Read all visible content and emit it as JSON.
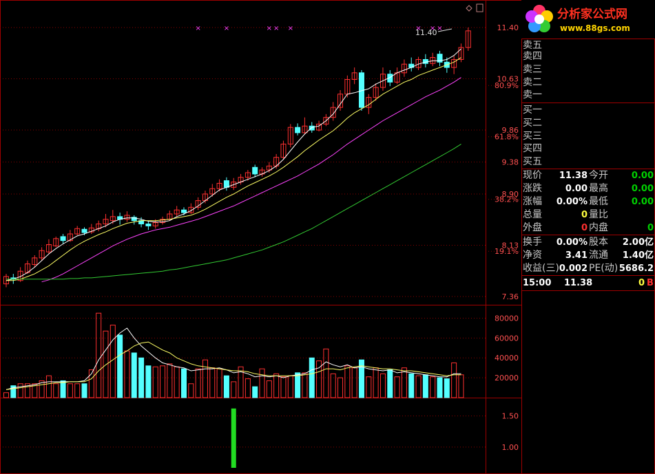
{
  "colors": {
    "up": "#ff3030",
    "down": "#54ffff",
    "ma5": "#ffffff",
    "ma10": "#ffff66",
    "ma20": "#ff44ff",
    "ma60": "#33cc33",
    "grid": "#8b0000",
    "axis_text": "#ff5050",
    "signal": "#22dd22",
    "marker": "#ff44ff"
  },
  "price_axis": {
    "ticks": [
      "11.40",
      "10.63",
      "9.86",
      "9.38",
      "8.90",
      "8.13",
      "7.36"
    ],
    "percent_labels": [
      "80.9%",
      "61.8%",
      "38.2%",
      "19.1%"
    ]
  },
  "price_annotation": "11.40",
  "volume_axis": {
    "ticks": [
      "80000",
      "60000",
      "40000",
      "20000"
    ]
  },
  "indicator_axis": {
    "ticks": [
      "1.50",
      "1.00"
    ]
  },
  "logo": {
    "title": "分析家公式网",
    "url": "www.88gs.com"
  },
  "order_book": {
    "sell": [
      "卖五",
      "卖四",
      "卖三",
      "卖二",
      "卖一"
    ],
    "buy": [
      "买一",
      "买二",
      "买三",
      "买四",
      "买五"
    ]
  },
  "quote": {
    "rows": [
      {
        "l1": "现价",
        "v1": "11.38",
        "l2": "今开",
        "v2": "0.00"
      },
      {
        "l1": "涨跌",
        "v1": "0.00",
        "l2": "最高",
        "v2": "0.00"
      },
      {
        "l1": "涨幅",
        "v1": "0.00%",
        "l2": "最低",
        "v2": "0.00"
      },
      {
        "l1": "总量",
        "v1": "0",
        "l2": "量比",
        "v2": ""
      },
      {
        "l1": "外盘",
        "v1": "0",
        "l2": "内盘",
        "v2": "0"
      }
    ],
    "rows2": [
      {
        "l1": "换手",
        "v1": "0.00%",
        "l2": "股本",
        "v2": "2.00亿"
      },
      {
        "l1": "净资",
        "v1": "3.41",
        "l2": "流通",
        "v2": "1.40亿"
      },
      {
        "l1": "收益(三)",
        "v1": "0.002",
        "l2": "PE(动)",
        "v2": "5686.2"
      }
    ]
  },
  "tick": {
    "time": "15:00",
    "price": "11.38",
    "vol": "0",
    "side": "B"
  },
  "chart_data": {
    "type": "candlestick",
    "price_range": [
      7.36,
      11.4
    ],
    "candles": [
      {
        "o": 7.55,
        "c": 7.66,
        "h": 7.7,
        "l": 7.5
      },
      {
        "o": 7.64,
        "c": 7.62,
        "h": 7.7,
        "l": 7.55
      },
      {
        "o": 7.6,
        "c": 7.74,
        "h": 7.8,
        "l": 7.58
      },
      {
        "o": 7.72,
        "c": 7.85,
        "h": 7.9,
        "l": 7.7
      },
      {
        "o": 7.84,
        "c": 7.94,
        "h": 7.98,
        "l": 7.8
      },
      {
        "o": 7.94,
        "c": 8.05,
        "h": 8.1,
        "l": 7.9
      },
      {
        "o": 8.03,
        "c": 8.14,
        "h": 8.22,
        "l": 8.0
      },
      {
        "o": 8.12,
        "c": 8.23,
        "h": 8.26,
        "l": 8.1
      },
      {
        "o": 8.26,
        "c": 8.2,
        "h": 8.3,
        "l": 8.15
      },
      {
        "o": 8.2,
        "c": 8.3,
        "h": 8.36,
        "l": 8.18
      },
      {
        "o": 8.3,
        "c": 8.38,
        "h": 8.42,
        "l": 8.28
      },
      {
        "o": 8.37,
        "c": 8.32,
        "h": 8.4,
        "l": 8.28
      },
      {
        "o": 8.33,
        "c": 8.39,
        "h": 8.45,
        "l": 8.3
      },
      {
        "o": 8.38,
        "c": 8.45,
        "h": 8.5,
        "l": 8.34
      },
      {
        "o": 8.45,
        "c": 8.52,
        "h": 8.6,
        "l": 8.4
      },
      {
        "o": 8.5,
        "c": 8.56,
        "h": 8.66,
        "l": 8.45
      },
      {
        "o": 8.56,
        "c": 8.52,
        "h": 8.62,
        "l": 8.44
      },
      {
        "o": 8.52,
        "c": 8.58,
        "h": 8.64,
        "l": 8.48
      },
      {
        "o": 8.55,
        "c": 8.5,
        "h": 8.58,
        "l": 8.44
      },
      {
        "o": 8.5,
        "c": 8.45,
        "h": 8.55,
        "l": 8.4
      },
      {
        "o": 8.45,
        "c": 8.42,
        "h": 8.5,
        "l": 8.36
      },
      {
        "o": 8.42,
        "c": 8.47,
        "h": 8.52,
        "l": 8.38
      },
      {
        "o": 8.47,
        "c": 8.52,
        "h": 8.56,
        "l": 8.44
      },
      {
        "o": 8.52,
        "c": 8.6,
        "h": 8.65,
        "l": 8.5
      },
      {
        "o": 8.6,
        "c": 8.66,
        "h": 8.72,
        "l": 8.56
      },
      {
        "o": 8.66,
        "c": 8.62,
        "h": 8.7,
        "l": 8.58
      },
      {
        "o": 8.62,
        "c": 8.7,
        "h": 8.76,
        "l": 8.6
      },
      {
        "o": 8.7,
        "c": 8.8,
        "h": 8.85,
        "l": 8.66
      },
      {
        "o": 8.8,
        "c": 8.9,
        "h": 8.95,
        "l": 8.76
      },
      {
        "o": 8.9,
        "c": 8.98,
        "h": 9.05,
        "l": 8.86
      },
      {
        "o": 8.98,
        "c": 9.06,
        "h": 9.12,
        "l": 8.94
      },
      {
        "o": 9.1,
        "c": 9.0,
        "h": 9.15,
        "l": 8.95
      },
      {
        "o": 9.0,
        "c": 9.08,
        "h": 9.14,
        "l": 8.96
      },
      {
        "o": 9.08,
        "c": 9.15,
        "h": 9.2,
        "l": 9.04
      },
      {
        "o": 9.15,
        "c": 9.22,
        "h": 9.26,
        "l": 9.1
      },
      {
        "o": 9.3,
        "c": 9.2,
        "h": 9.34,
        "l": 9.15
      },
      {
        "o": 9.2,
        "c": 9.26,
        "h": 9.3,
        "l": 9.16
      },
      {
        "o": 9.26,
        "c": 9.32,
        "h": 9.38,
        "l": 9.22
      },
      {
        "o": 9.32,
        "c": 9.45,
        "h": 9.5,
        "l": 9.28
      },
      {
        "o": 9.45,
        "c": 9.65,
        "h": 9.7,
        "l": 9.42
      },
      {
        "o": 9.65,
        "c": 9.9,
        "h": 9.95,
        "l": 9.6
      },
      {
        "o": 9.9,
        "c": 9.82,
        "h": 9.96,
        "l": 9.78
      },
      {
        "o": 9.82,
        "c": 9.92,
        "h": 10.05,
        "l": 9.8
      },
      {
        "o": 9.92,
        "c": 9.86,
        "h": 9.98,
        "l": 9.82
      },
      {
        "o": 9.86,
        "c": 9.95,
        "h": 10.0,
        "l": 9.84
      },
      {
        "o": 9.95,
        "c": 10.05,
        "h": 10.1,
        "l": 9.92
      },
      {
        "o": 10.05,
        "c": 10.2,
        "h": 10.28,
        "l": 10.0
      },
      {
        "o": 10.2,
        "c": 10.4,
        "h": 10.46,
        "l": 10.15
      },
      {
        "o": 10.4,
        "c": 10.62,
        "h": 10.68,
        "l": 10.35
      },
      {
        "o": 10.62,
        "c": 10.72,
        "h": 10.8,
        "l": 10.55
      },
      {
        "o": 10.72,
        "c": 10.2,
        "h": 10.76,
        "l": 10.15
      },
      {
        "o": 10.2,
        "c": 10.35,
        "h": 10.4,
        "l": 10.1
      },
      {
        "o": 10.35,
        "c": 10.5,
        "h": 10.56,
        "l": 10.3
      },
      {
        "o": 10.5,
        "c": 10.7,
        "h": 10.8,
        "l": 10.45
      },
      {
        "o": 10.7,
        "c": 10.58,
        "h": 10.76,
        "l": 10.52
      },
      {
        "o": 10.58,
        "c": 10.72,
        "h": 10.8,
        "l": 10.55
      },
      {
        "o": 10.72,
        "c": 10.85,
        "h": 10.92,
        "l": 10.66
      },
      {
        "o": 10.85,
        "c": 10.8,
        "h": 10.95,
        "l": 10.74
      },
      {
        "o": 10.8,
        "c": 10.92,
        "h": 10.96,
        "l": 10.76
      },
      {
        "o": 10.92,
        "c": 10.86,
        "h": 11.0,
        "l": 10.8
      },
      {
        "o": 10.86,
        "c": 10.95,
        "h": 11.02,
        "l": 10.82
      },
      {
        "o": 11.0,
        "c": 10.88,
        "h": 11.05,
        "l": 10.82
      },
      {
        "o": 10.88,
        "c": 10.8,
        "h": 10.95,
        "l": 10.72
      },
      {
        "o": 10.8,
        "c": 10.92,
        "h": 10.98,
        "l": 10.7
      },
      {
        "o": 10.92,
        "c": 11.1,
        "h": 11.16,
        "l": 10.88
      },
      {
        "o": 11.1,
        "c": 11.35,
        "h": 11.4,
        "l": 11.05
      }
    ],
    "ma_series": [
      {
        "name": "MA5",
        "values": [
          7.6,
          7.62,
          7.66,
          7.72,
          7.8,
          7.9,
          8.0,
          8.08,
          8.15,
          8.21,
          8.27,
          8.3,
          8.34,
          8.38,
          8.42,
          8.48,
          8.52,
          8.54,
          8.54,
          8.52,
          8.49,
          8.48,
          8.48,
          8.5,
          8.56,
          8.6,
          8.65,
          8.72,
          8.8,
          8.88,
          8.96,
          9.0,
          9.04,
          9.08,
          9.12,
          9.16,
          9.2,
          9.25,
          9.32,
          9.42,
          9.55,
          9.68,
          9.8,
          9.9,
          9.92,
          10.0,
          10.1,
          10.25,
          10.4,
          10.42,
          10.45,
          10.48,
          10.55,
          10.6,
          10.65,
          10.72,
          10.76,
          10.8,
          10.85,
          10.88,
          10.9,
          10.9,
          10.92,
          10.98,
          11.08
        ]
      },
      {
        "name": "MA10",
        "values": [
          7.6,
          7.6,
          7.62,
          7.66,
          7.7,
          7.76,
          7.82,
          7.9,
          7.98,
          8.06,
          8.13,
          8.19,
          8.24,
          8.29,
          8.33,
          8.38,
          8.42,
          8.46,
          8.48,
          8.5,
          8.5,
          8.5,
          8.51,
          8.52,
          8.54,
          8.56,
          8.58,
          8.62,
          8.67,
          8.73,
          8.79,
          8.85,
          8.9,
          8.96,
          9.02,
          9.07,
          9.12,
          9.17,
          9.23,
          9.3,
          9.38,
          9.46,
          9.55,
          9.63,
          9.71,
          9.78,
          9.85,
          9.94,
          10.04,
          10.12,
          10.18,
          10.24,
          10.32,
          10.4,
          10.46,
          10.52,
          10.58,
          10.62,
          10.68,
          10.72,
          10.76,
          10.8,
          10.84,
          10.88,
          10.95
        ]
      },
      {
        "name": "MA20",
        "values": [
          null,
          null,
          null,
          null,
          null,
          7.58,
          7.61,
          7.65,
          7.7,
          7.76,
          7.82,
          7.88,
          7.94,
          8.0,
          8.06,
          8.12,
          8.17,
          8.22,
          8.26,
          8.3,
          8.33,
          8.36,
          8.38,
          8.4,
          8.43,
          8.46,
          8.49,
          8.52,
          8.56,
          8.6,
          8.64,
          8.68,
          8.72,
          8.77,
          8.82,
          8.87,
          8.92,
          8.97,
          9.02,
          9.07,
          9.12,
          9.17,
          9.23,
          9.29,
          9.35,
          9.42,
          9.49,
          9.57,
          9.65,
          9.72,
          9.79,
          9.86,
          9.93,
          10.0,
          10.06,
          10.12,
          10.18,
          10.24,
          10.3,
          10.36,
          10.41,
          10.46,
          10.52,
          10.58,
          10.65
        ]
      },
      {
        "name": "MA60",
        "values": [
          7.62,
          7.62,
          7.62,
          7.62,
          7.62,
          7.62,
          7.62,
          7.62,
          7.62,
          7.63,
          7.63,
          7.64,
          7.64,
          7.65,
          7.66,
          7.67,
          7.68,
          7.69,
          7.7,
          7.71,
          7.72,
          7.73,
          7.74,
          7.76,
          7.77,
          7.79,
          7.81,
          7.83,
          7.85,
          7.87,
          7.89,
          7.91,
          7.94,
          7.97,
          8.0,
          8.03,
          8.06,
          8.1,
          8.14,
          8.18,
          8.23,
          8.28,
          8.33,
          8.38,
          8.44,
          8.5,
          8.56,
          8.62,
          8.68,
          8.74,
          8.8,
          8.86,
          8.92,
          8.98,
          9.04,
          9.1,
          9.16,
          9.22,
          9.28,
          9.34,
          9.4,
          9.46,
          9.52,
          9.58,
          9.65
        ]
      }
    ],
    "volume": [
      5000,
      12000,
      14000,
      14000,
      14000,
      17000,
      22000,
      14000,
      17000,
      14000,
      14000,
      14000,
      28000,
      85000,
      67000,
      73000,
      63000,
      47000,
      45000,
      40000,
      32000,
      31000,
      32000,
      34000,
      31000,
      29000,
      14000,
      29000,
      38000,
      30000,
      29000,
      22000,
      16000,
      31000,
      19000,
      11000,
      29000,
      17000,
      24000,
      21000,
      22000,
      25000,
      25000,
      40000,
      37000,
      49000,
      24000,
      20000,
      32000,
      30000,
      38000,
      21000,
      30000,
      24000,
      28000,
      21000,
      30000,
      24000,
      22000,
      23000,
      21000,
      20000,
      19000,
      35000,
      23000
    ],
    "volume_ma": [
      {
        "name": "VOL_MA5",
        "values": [
          8000,
          10000,
          11000,
          12000,
          13000,
          15000,
          16000,
          16000,
          16000,
          16000,
          16000,
          17000,
          24000,
          38000,
          48000,
          58000,
          65000,
          70000,
          60000,
          52000,
          46000,
          40000,
          35000,
          33000,
          31000,
          30000,
          27000,
          28000,
          29000,
          29000,
          30000,
          28000,
          25000,
          26000,
          24000,
          21000,
          22000,
          21000,
          22000,
          20000,
          22000,
          23000,
          24000,
          28000,
          30000,
          36000,
          33000,
          31000,
          33000,
          30000,
          31000,
          29000,
          28000,
          27000,
          28000,
          25000,
          26000,
          25000,
          24000,
          23000,
          22000,
          21000,
          21000,
          24000,
          24000
        ]
      },
      {
        "name": "VOL_MA10",
        "values": [
          8000,
          9000,
          10000,
          11000,
          12000,
          13000,
          14000,
          15000,
          15000,
          16000,
          16000,
          16000,
          19000,
          27000,
          33000,
          38000,
          43000,
          47000,
          52000,
          55000,
          56000,
          52000,
          48000,
          45000,
          40000,
          37000,
          34000,
          32000,
          31000,
          30000,
          29000,
          28000,
          27000,
          27000,
          26000,
          24000,
          23000,
          22000,
          22000,
          22000,
          22000,
          22000,
          23000,
          24000,
          26000,
          29000,
          29000,
          28000,
          30000,
          31000,
          32000,
          31000,
          30000,
          29000,
          29000,
          28000,
          27000,
          27000,
          26000,
          25000,
          24000,
          23000,
          22000,
          23000,
          23000
        ]
      }
    ],
    "indicator": {
      "bar_index": 32,
      "value": 1.62,
      "range": [
        0.6,
        1.75
      ]
    },
    "x_markers": [
      27,
      31,
      37,
      38,
      40,
      58,
      60,
      61
    ]
  }
}
